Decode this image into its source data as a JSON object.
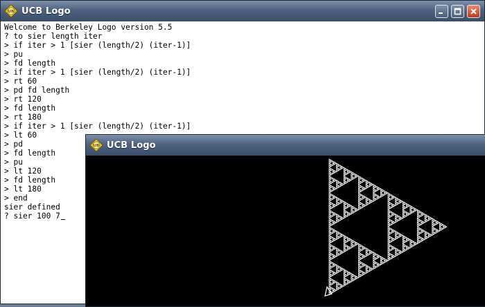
{
  "console_window": {
    "title": "UCB Logo",
    "icon": "ucb-logo-icon",
    "lines": [
      "Welcome to Berkeley Logo version 5.5",
      "? to sier length iter",
      "> if iter > 1 [sier (length/2) (iter-1)]",
      "> pu",
      "> fd length",
      "> if iter > 1 [sier (length/2) (iter-1)]",
      "> rt 60",
      "> pd fd length",
      "> rt 120",
      "> fd length",
      "> rt 180",
      "> if iter > 1 [sier (length/2) (iter-1)]",
      "> lt 60",
      "> pd",
      "> fd length",
      "> pu",
      "> lt 120",
      "> fd length",
      "> lt 180",
      "> end",
      "sier defined",
      "? sier 100 7"
    ]
  },
  "graphics_window": {
    "title": "UCB Logo",
    "icon": "ucb-logo-icon",
    "drawing": {
      "shape": "sierpinski-triangle",
      "length": 100,
      "iterations": 7,
      "pen_color": "#ffffff",
      "background": "#000000"
    },
    "turtle": "turtle-icon"
  },
  "window_controls": [
    "minimize-icon",
    "maximize-icon",
    "close-icon"
  ],
  "colors": {
    "titlebar": "#4f6381",
    "close": "#c0381a",
    "logo_badge": "#f2c40c"
  }
}
